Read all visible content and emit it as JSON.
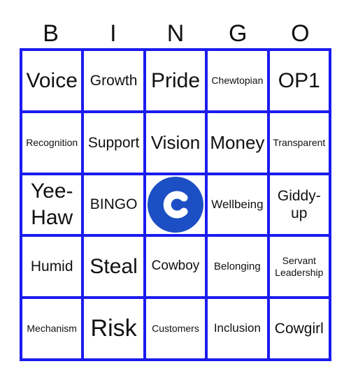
{
  "header": {
    "letters": [
      "B",
      "I",
      "N",
      "G",
      "O"
    ]
  },
  "colors": {
    "grid": "#1b1bf0",
    "logo": "#1c4fc4"
  },
  "free_space": {
    "icon": "company-logo-c-icon"
  },
  "cells": [
    [
      "Voice",
      "Growth",
      "Pride",
      "Chewtopian",
      "OP1"
    ],
    [
      "Recognition",
      "Support",
      "Vision",
      "Money",
      "Transparent"
    ],
    [
      "Yee-Haw",
      "BINGO",
      "",
      "Wellbeing",
      "Giddy-up"
    ],
    [
      "Humid",
      "Steal",
      "Cowboy",
      "Belonging",
      "Servant Leadership"
    ],
    [
      "Mechanism",
      "Risk",
      "Customers",
      "Inclusion",
      "Cowgirl"
    ]
  ]
}
